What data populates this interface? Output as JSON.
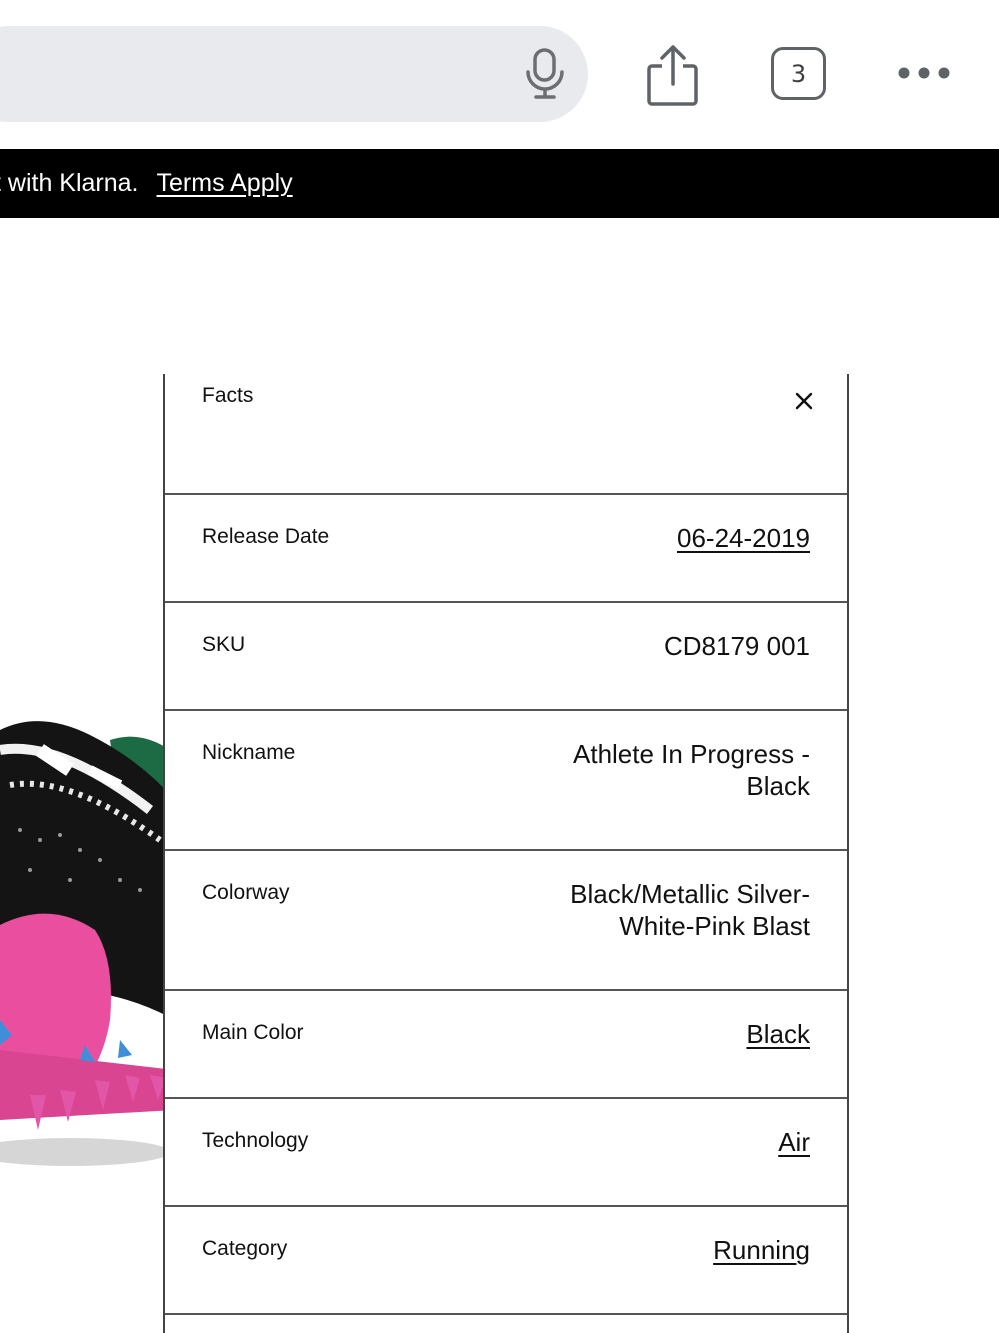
{
  "browser": {
    "tabs_count": "3",
    "icons": {
      "mic": "microphone-icon",
      "share": "share-icon",
      "more": "more-dots-icon"
    }
  },
  "banner": {
    "text": "t with Klarna.",
    "link": "Terms Apply"
  },
  "facts": {
    "title": "Facts",
    "close_icon": "close-icon",
    "rows": [
      {
        "label": "Release Date",
        "value": "06-24-2019"
      },
      {
        "label": "SKU",
        "value": "CD8179 001"
      },
      {
        "label": "Nickname",
        "value": "Athlete In Progress - Black"
      },
      {
        "label": "Colorway",
        "value": "Black/Metallic Silver-White-Pink Blast"
      },
      {
        "label": "Main Color",
        "value": "Black"
      },
      {
        "label": "Technology",
        "value": "Air"
      },
      {
        "label": "Category",
        "value": "Running"
      }
    ]
  },
  "colors": {
    "banner_bg": "#000000",
    "url_bar_bg": "#e9eaee",
    "border": "#555555",
    "shoe_pink": "#ea4f9f",
    "shoe_green": "#1c6b45"
  }
}
